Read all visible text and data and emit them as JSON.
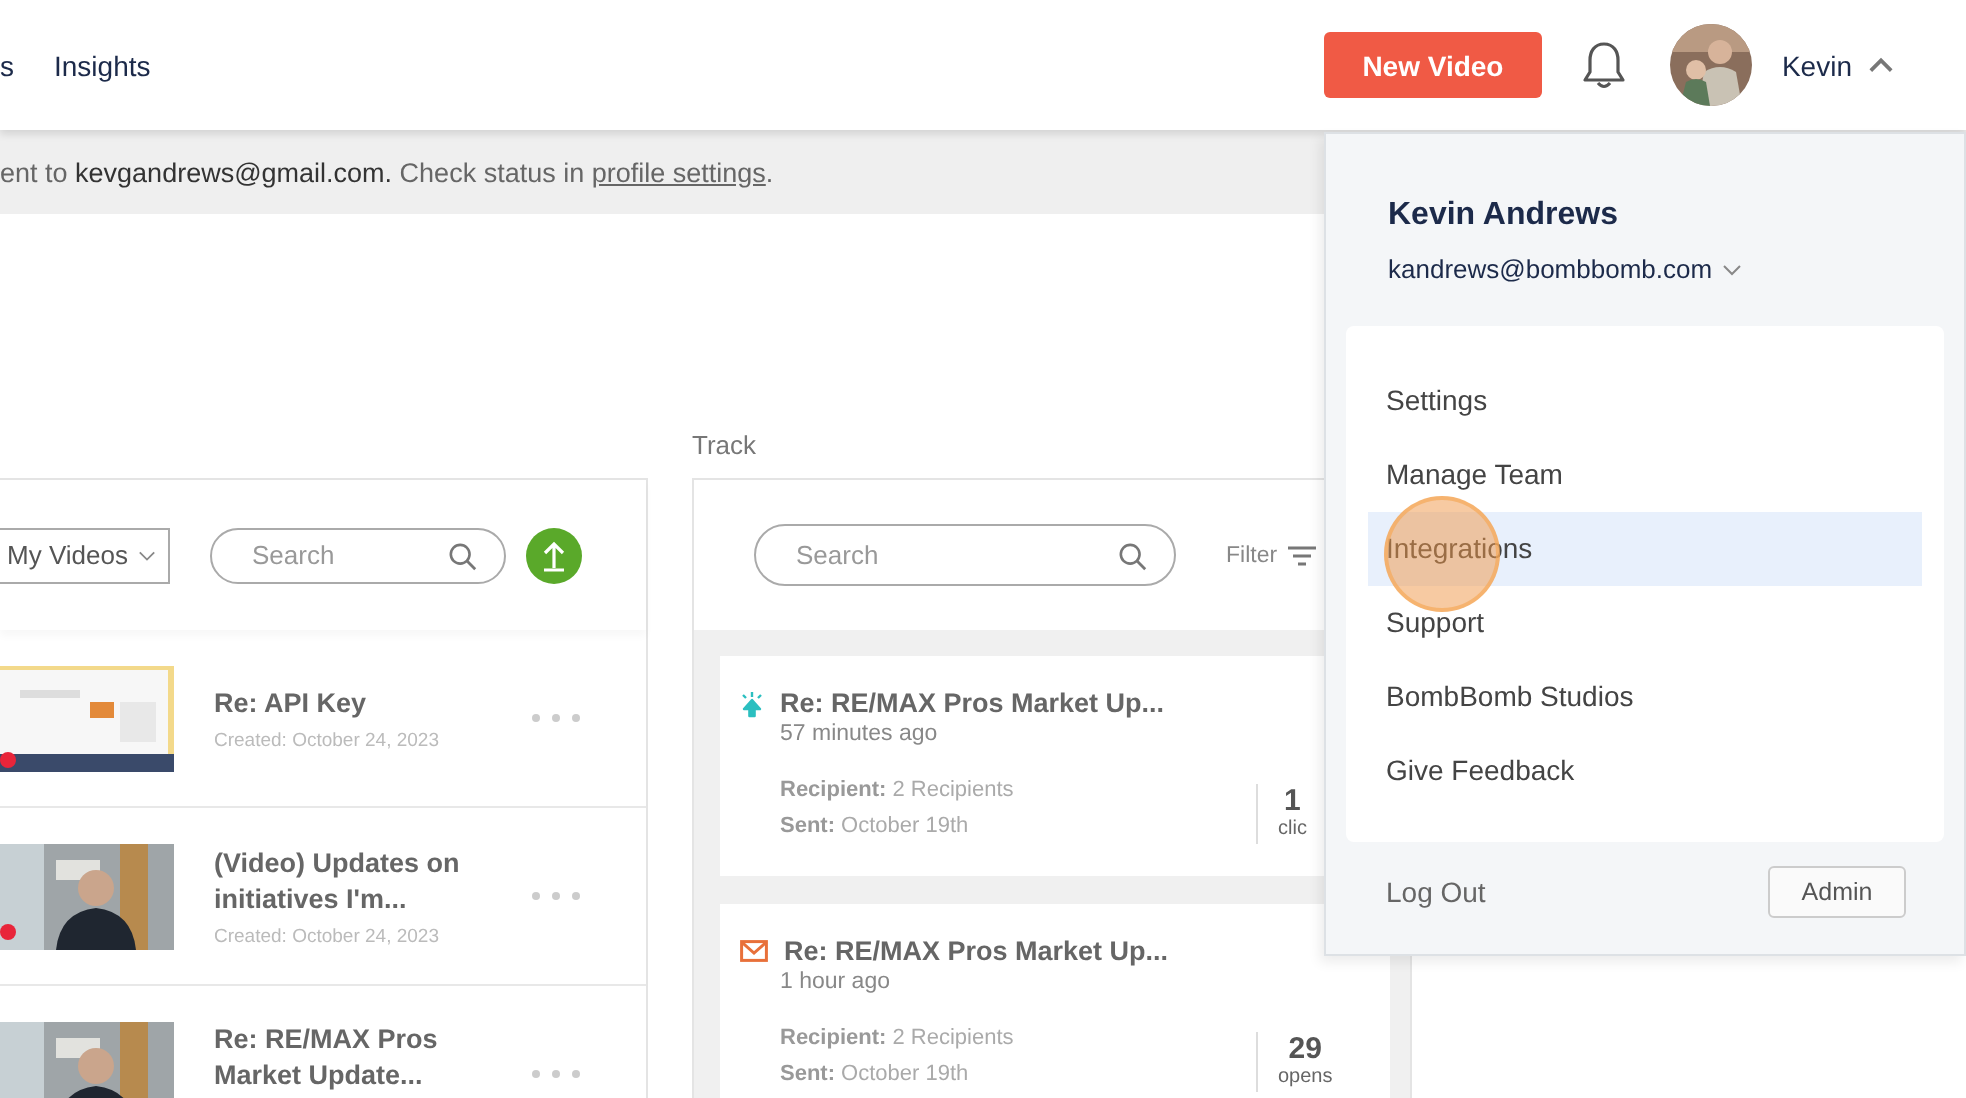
{
  "nav": {
    "items": [
      "s",
      "Insights"
    ]
  },
  "header": {
    "new_video_button": "New Video",
    "user_name": "Kevin",
    "menu_expanded": true
  },
  "notice": {
    "text_start": "ent to",
    "email": "kevgandrews@gmail.com.",
    "text_mid": "Check status in",
    "link": "profile settings",
    "text_end": "."
  },
  "videos": {
    "filter": "My Videos",
    "search_placeholder": "Search",
    "rows": [
      {
        "title": "Re: API Key",
        "created": "Created: October 24, 2023"
      },
      {
        "title": "(Video) Updates on initiatives I'm...",
        "created": "Created: October 24, 2023"
      },
      {
        "title": "Re: RE/MAX Pros Market Update..."
      }
    ]
  },
  "track": {
    "label": "Track",
    "search_placeholder": "Search",
    "filter": "Filter",
    "cards": [
      {
        "kind": "click",
        "title": "Re: RE/MAX Pros Market Up...",
        "time": "57 minutes ago",
        "recipient_label": "Recipient:",
        "recipient": "2 Recipients",
        "sent_label": "Sent:",
        "sent": "October 19th",
        "count": "1",
        "count_label": "clic"
      },
      {
        "kind": "open",
        "title": "Re: RE/MAX Pros Market Up...",
        "time": "1 hour ago",
        "recipient_label": "Recipient:",
        "recipient": "2 Recipients",
        "sent_label": "Sent:",
        "sent": "October 19th",
        "count": "29",
        "count_label": "opens"
      }
    ]
  },
  "account_menu": {
    "name": "Kevin Andrews",
    "email": "kandrews@bombbomb.com",
    "items": [
      {
        "label": "Settings",
        "selected": false
      },
      {
        "label": "Manage Team",
        "selected": false
      },
      {
        "label": "Integrations",
        "selected": true
      },
      {
        "label": "Support",
        "selected": false
      },
      {
        "label": "BombBomb Studios",
        "selected": false
      },
      {
        "label": "Give Feedback",
        "selected": false
      }
    ],
    "logout": "Log Out",
    "admin_button": "Admin"
  }
}
